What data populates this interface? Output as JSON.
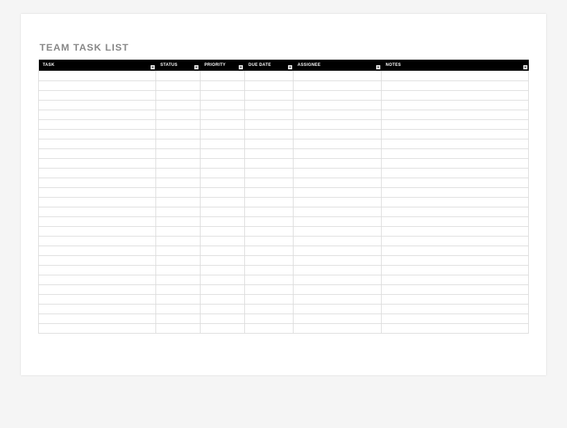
{
  "title": "TEAM TASK LIST",
  "columns": {
    "task": "TASK",
    "status": "STATUS",
    "priority": "PRIORITY",
    "duedate": "DUE DATE",
    "assignee": "ASSIGNEE",
    "notes": "NOTES"
  },
  "row_count": 27,
  "rows": [
    {
      "task": "",
      "status": "",
      "priority": "",
      "duedate": "",
      "assignee": "",
      "notes": ""
    },
    {
      "task": "",
      "status": "",
      "priority": "",
      "duedate": "",
      "assignee": "",
      "notes": ""
    },
    {
      "task": "",
      "status": "",
      "priority": "",
      "duedate": "",
      "assignee": "",
      "notes": ""
    },
    {
      "task": "",
      "status": "",
      "priority": "",
      "duedate": "",
      "assignee": "",
      "notes": ""
    },
    {
      "task": "",
      "status": "",
      "priority": "",
      "duedate": "",
      "assignee": "",
      "notes": ""
    },
    {
      "task": "",
      "status": "",
      "priority": "",
      "duedate": "",
      "assignee": "",
      "notes": ""
    },
    {
      "task": "",
      "status": "",
      "priority": "",
      "duedate": "",
      "assignee": "",
      "notes": ""
    },
    {
      "task": "",
      "status": "",
      "priority": "",
      "duedate": "",
      "assignee": "",
      "notes": ""
    },
    {
      "task": "",
      "status": "",
      "priority": "",
      "duedate": "",
      "assignee": "",
      "notes": ""
    },
    {
      "task": "",
      "status": "",
      "priority": "",
      "duedate": "",
      "assignee": "",
      "notes": ""
    },
    {
      "task": "",
      "status": "",
      "priority": "",
      "duedate": "",
      "assignee": "",
      "notes": ""
    },
    {
      "task": "",
      "status": "",
      "priority": "",
      "duedate": "",
      "assignee": "",
      "notes": ""
    },
    {
      "task": "",
      "status": "",
      "priority": "",
      "duedate": "",
      "assignee": "",
      "notes": ""
    },
    {
      "task": "",
      "status": "",
      "priority": "",
      "duedate": "",
      "assignee": "",
      "notes": ""
    },
    {
      "task": "",
      "status": "",
      "priority": "",
      "duedate": "",
      "assignee": "",
      "notes": ""
    },
    {
      "task": "",
      "status": "",
      "priority": "",
      "duedate": "",
      "assignee": "",
      "notes": ""
    },
    {
      "task": "",
      "status": "",
      "priority": "",
      "duedate": "",
      "assignee": "",
      "notes": ""
    },
    {
      "task": "",
      "status": "",
      "priority": "",
      "duedate": "",
      "assignee": "",
      "notes": ""
    },
    {
      "task": "",
      "status": "",
      "priority": "",
      "duedate": "",
      "assignee": "",
      "notes": ""
    },
    {
      "task": "",
      "status": "",
      "priority": "",
      "duedate": "",
      "assignee": "",
      "notes": ""
    },
    {
      "task": "",
      "status": "",
      "priority": "",
      "duedate": "",
      "assignee": "",
      "notes": ""
    },
    {
      "task": "",
      "status": "",
      "priority": "",
      "duedate": "",
      "assignee": "",
      "notes": ""
    },
    {
      "task": "",
      "status": "",
      "priority": "",
      "duedate": "",
      "assignee": "",
      "notes": ""
    },
    {
      "task": "",
      "status": "",
      "priority": "",
      "duedate": "",
      "assignee": "",
      "notes": ""
    },
    {
      "task": "",
      "status": "",
      "priority": "",
      "duedate": "",
      "assignee": "",
      "notes": ""
    },
    {
      "task": "",
      "status": "",
      "priority": "",
      "duedate": "",
      "assignee": "",
      "notes": ""
    },
    {
      "task": "",
      "status": "",
      "priority": "",
      "duedate": "",
      "assignee": "",
      "notes": ""
    }
  ]
}
